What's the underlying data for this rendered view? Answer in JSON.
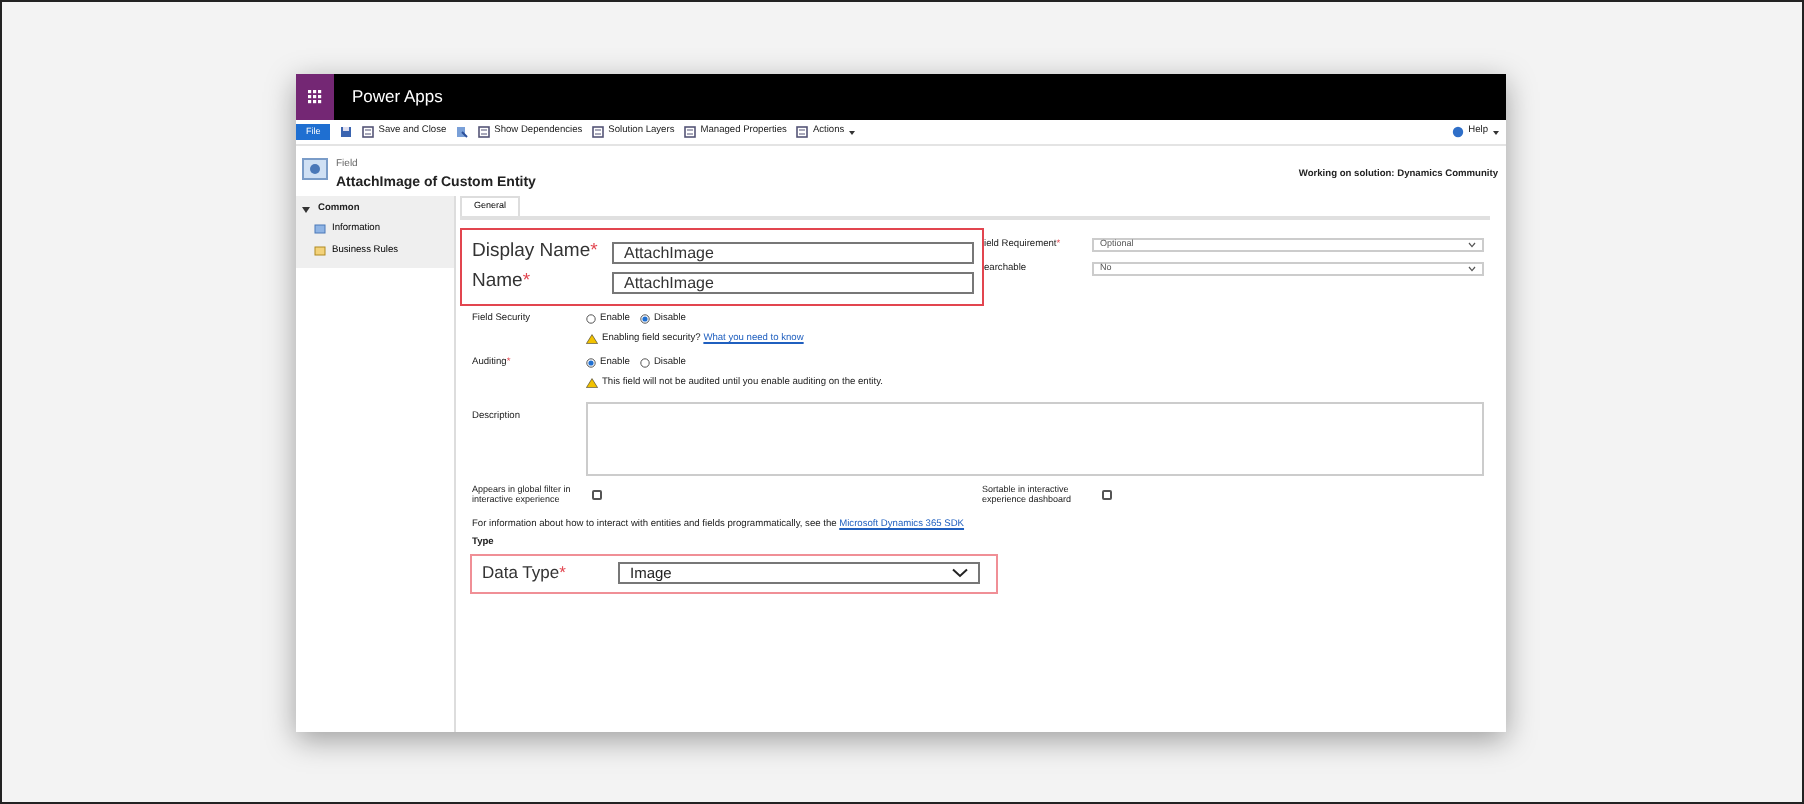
{
  "app": {
    "title": "Power Apps"
  },
  "toolbar": {
    "file": "File",
    "items": [
      {
        "kind": "icon"
      },
      {
        "kind": "labeled",
        "label": "Save and Close"
      },
      {
        "kind": "icon"
      },
      {
        "kind": "labeled",
        "label": "Show Dependencies"
      },
      {
        "kind": "labeled",
        "label": "Solution Layers"
      },
      {
        "kind": "labeled",
        "label": "Managed Properties"
      },
      {
        "kind": "menu",
        "label": "Actions"
      }
    ],
    "help": "Help"
  },
  "header": {
    "type": "Field",
    "title": "AttachImage of Custom Entity",
    "solution": "Working on solution: Dynamics Community"
  },
  "nav": {
    "group": "Common",
    "items": [
      {
        "label": "Information"
      },
      {
        "label": "Business Rules"
      }
    ]
  },
  "tabs": [
    {
      "label": "General",
      "selected": true
    }
  ],
  "highlight_fields": [
    {
      "label": "Display Name",
      "required_mark": "*",
      "value": "AttachImage"
    },
    {
      "label": "Name",
      "required_mark": "*",
      "value": "AttachImage"
    }
  ],
  "side_fields": [
    {
      "label": "ield Requirement",
      "required_mark": "*",
      "value": "Optional"
    },
    {
      "label": "earchable",
      "value": "No"
    }
  ],
  "radio_groups": [
    {
      "label": "Field Security",
      "options": [
        {
          "label": "Enable",
          "selected": false
        },
        {
          "label": "Disable",
          "selected": true
        }
      ],
      "note": "Enabling field security?",
      "note_link": "What you need to know"
    },
    {
      "label": "Auditing",
      "required_mark": "*",
      "options": [
        {
          "label": "Enable",
          "selected": true
        },
        {
          "label": "Disable",
          "selected": false
        }
      ],
      "note": "This field will not be audited until you enable auditing on the entity."
    }
  ],
  "description": {
    "label": "Description"
  },
  "checkboxes": [
    {
      "label": "Appears in global filter in interactive experience",
      "checked": false
    },
    {
      "label": "Sortable in interactive experience dashboard",
      "checked": false
    }
  ],
  "info": {
    "text": "For information about how to interact with entities and fields programmatically, see the",
    "link": "Microsoft Dynamics 365 SDK"
  },
  "type_section": {
    "title": "Type",
    "field": {
      "label": "Data Type",
      "required_mark": "*",
      "value": "Image"
    }
  }
}
